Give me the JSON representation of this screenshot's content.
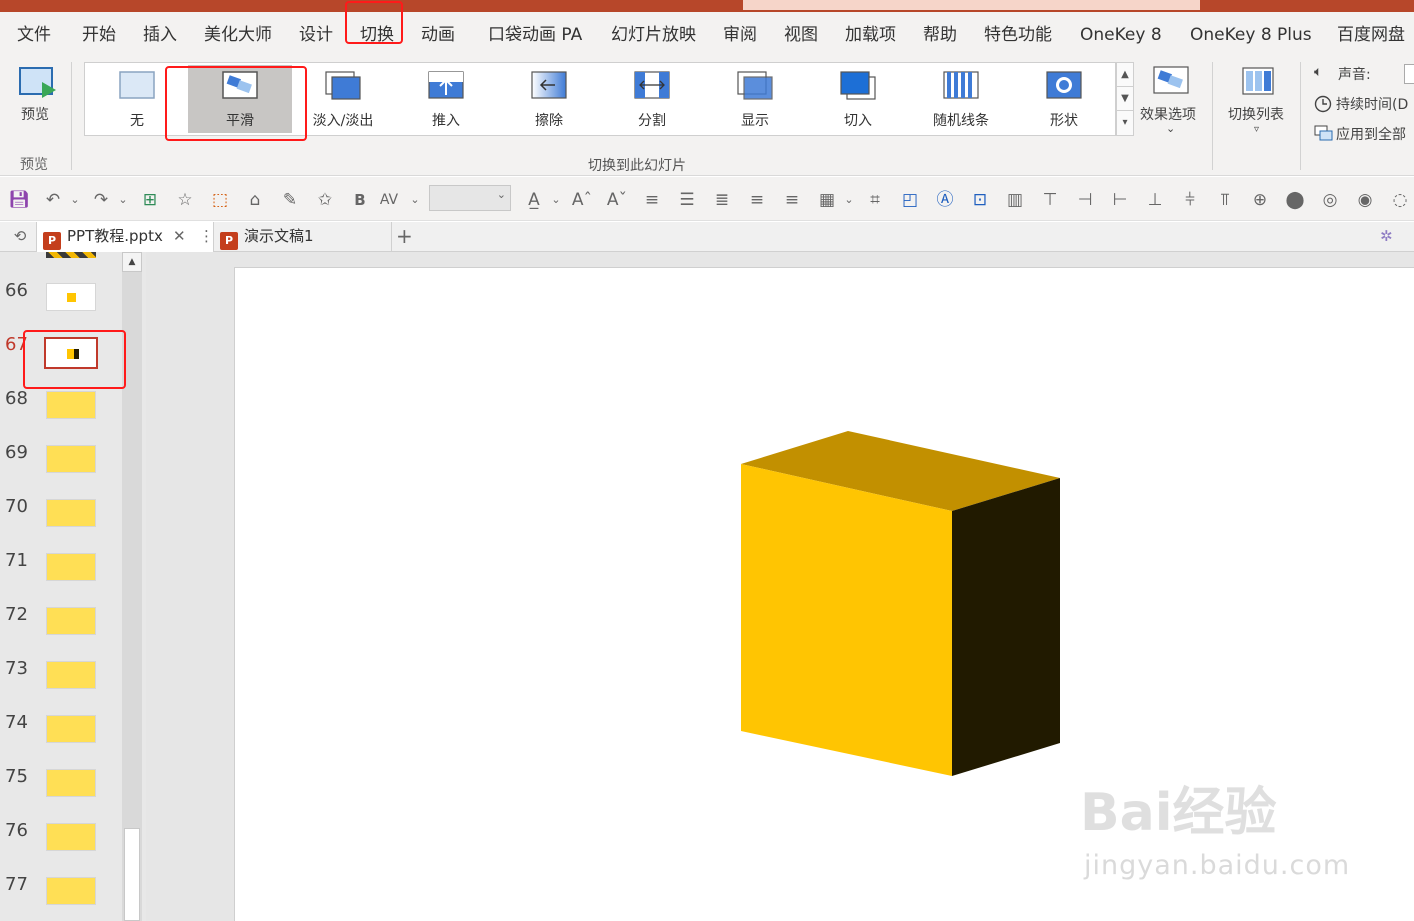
{
  "menubar": {
    "items": [
      "文件",
      "开始",
      "插入",
      "美化大师",
      "设计",
      "切换",
      "动画",
      "口袋动画 PA",
      "幻灯片放映",
      "审阅",
      "视图",
      "加载项",
      "帮助",
      "特色功能",
      "OneKey 8",
      "OneKey 8 Plus",
      "百度网盘"
    ],
    "active": "切换"
  },
  "ribbon": {
    "preview_label": "预览",
    "preview_group": "预览",
    "transitions": [
      "无",
      "平滑",
      "淡入/淡出",
      "推入",
      "擦除",
      "分割",
      "显示",
      "切入",
      "随机线条",
      "形状"
    ],
    "selected_transition": "平滑",
    "group_label": "切换到此幻灯片",
    "effect_options": "效果选项",
    "transition_list": "切换列表",
    "sound_label": "声音:",
    "duration_label": "持续时间(D",
    "apply_all_label": "应用到全部"
  },
  "tabs": [
    {
      "label": "PPT教程.pptx",
      "active": true
    },
    {
      "label": "演示文稿1",
      "active": false
    }
  ],
  "thumbnails": {
    "numbers": [
      "66",
      "67",
      "68",
      "69",
      "70",
      "71",
      "72",
      "73",
      "74",
      "75",
      "76",
      "77"
    ],
    "current": "67"
  },
  "slide": {
    "shape": "cube",
    "colors": {
      "front": "#ffc502",
      "top": "#c29000",
      "side": "#211a00"
    }
  },
  "colors": {
    "accent": "#b7472a",
    "highlight": "#ff1a1a",
    "selected_thumb_border": "#c0392b",
    "thumb_fill": "#ffdf55"
  },
  "watermark": {
    "main": "Bai经验",
    "sub": "jingyan.baidu.com"
  }
}
